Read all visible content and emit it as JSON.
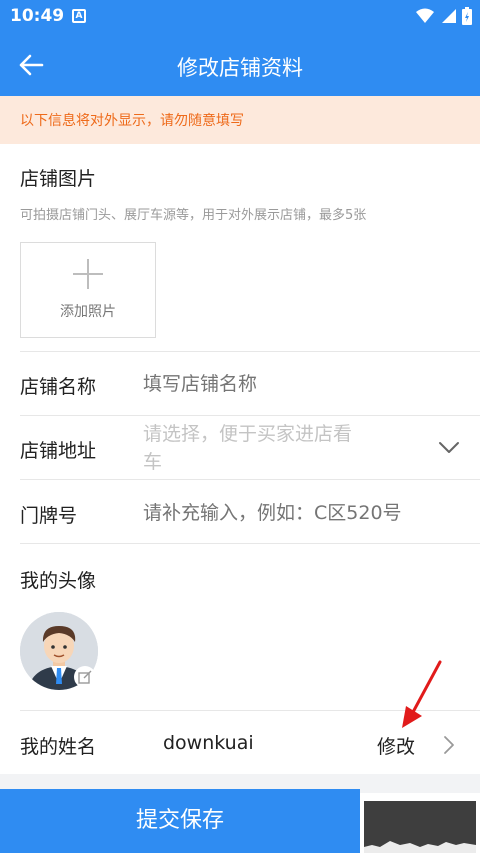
{
  "status": {
    "time": "10:49",
    "notif_letter": "A"
  },
  "header": {
    "title": "修改店铺资料"
  },
  "notice": {
    "text": "以下信息将对外显示，请勿随意填写"
  },
  "photos": {
    "title": "店铺图片",
    "desc": "可拍摄店铺门头、展厅车源等，用于对外展示店铺，最多5张",
    "add_label": "添加照片"
  },
  "form": {
    "name": {
      "label": "店铺名称",
      "placeholder": "填写店铺名称"
    },
    "address": {
      "label": "店铺地址",
      "placeholder_line1": "请选择，便于买家进店看",
      "placeholder_line2": "车"
    },
    "door": {
      "label": "门牌号",
      "placeholder": "请补充输入，例如：C区520号"
    }
  },
  "avatar": {
    "title": "我的头像"
  },
  "my_name": {
    "label": "我的姓名",
    "value": "downkuai",
    "action": "修改"
  },
  "footer": {
    "submit_label": "提交保存"
  },
  "colors": {
    "primary": "#2f8cf2",
    "notice_bg": "#fde9dc",
    "notice_text": "#ee6a1a",
    "annotation": "#e11b1b"
  }
}
